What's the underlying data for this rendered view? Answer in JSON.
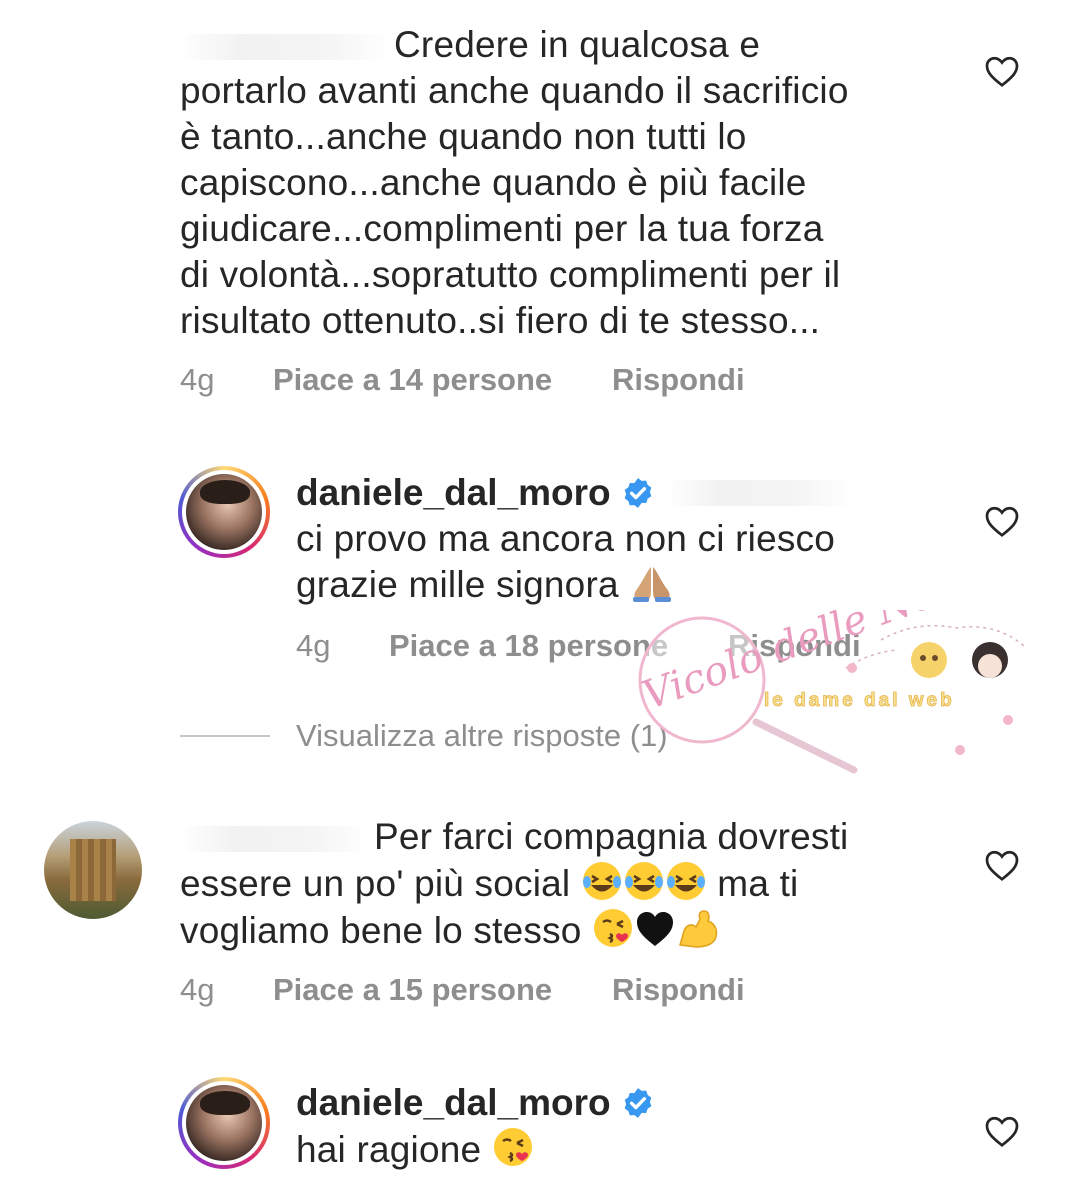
{
  "comments": [
    {
      "text": "Credere in qualcosa e\nportarlo avanti anche quando il sacrificio\nè tanto...anche quando non tutti lo\ncapiscono...anche quando è più facile\ngiudicare...complimenti per la tua forza\ndi volontà...sopratutto complimenti per il\nrisultato ottenuto..si fiero di te stesso...",
      "time": "4g",
      "likes": "Piace a 14 persone",
      "reply": "Rispondi"
    },
    {
      "username": "daniele_dal_moro",
      "text": "ci provo ma ancora non ci riesco\ngrazie mille signora",
      "time": "4g",
      "likes": "Piace a 18 persone",
      "reply": "Rispondi"
    },
    {
      "text_line1": "Per farci compagnia dovresti",
      "text_line2a": "essere un po' più social",
      "text_line2b": "ma ti",
      "text_line3": "vogliamo bene lo stesso",
      "time": "4g",
      "likes": "Piace a 15 persone",
      "reply": "Rispondi"
    },
    {
      "username": "daniele_dal_moro",
      "text": "hai ragione"
    }
  ],
  "view_more_replies": "Visualizza altre risposte (1)",
  "watermark": {
    "script": "Vicolo delle News",
    "tag": "le dame dal web"
  },
  "icons": {
    "like": "heart-outline-icon",
    "verified": "verified-badge-icon"
  },
  "colors": {
    "text": "#262626",
    "secondary": "#8e8e8e",
    "verified": "#3897f0"
  }
}
